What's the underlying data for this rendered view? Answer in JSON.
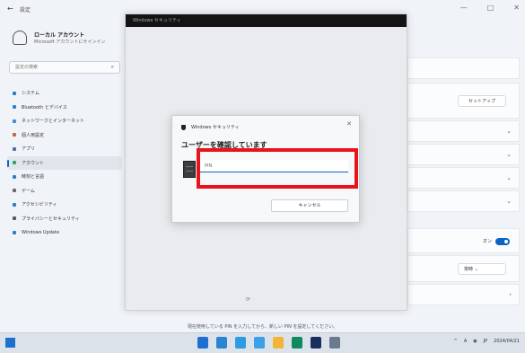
{
  "settings": {
    "back": "←",
    "app_title": "設定",
    "window_controls": [
      "—",
      "□",
      "✕"
    ],
    "profile": {
      "name": "ローカル アカウント",
      "subtitle": "Microsoft アカウントにサインイン"
    },
    "search_placeholder": "設定の検索",
    "nav": [
      {
        "label": "システム",
        "color": "#2f7bd6"
      },
      {
        "label": "Bluetooth とデバイス",
        "color": "#2f7bd6"
      },
      {
        "label": "ネットワークとインターネット",
        "color": "#3b8fd9"
      },
      {
        "label": "個人用設定",
        "color": "#c56a36"
      },
      {
        "label": "アプリ",
        "color": "#4e6fa8"
      },
      {
        "label": "アカウント",
        "color": "#2fa36b",
        "active": true
      },
      {
        "label": "時刻と言語",
        "color": "#2f7bd6"
      },
      {
        "label": "ゲーム",
        "color": "#6a6a6a"
      },
      {
        "label": "アクセシビリティ",
        "color": "#2f7bd6"
      },
      {
        "label": "プライバシーとセキュリティ",
        "color": "#5a5a5a"
      },
      {
        "label": "Windows Update",
        "color": "#2f7bd6"
      }
    ],
    "right_cards": {
      "button_label": "セットアップ",
      "toggle_label": "オン",
      "select_label": "常時"
    }
  },
  "security_window": {
    "title": "Windows セキュリティ",
    "footer": "⟳"
  },
  "dialog": {
    "header": "Windows セキュリティ",
    "close": "✕",
    "title": "ユーザーを確認しています",
    "pin_placeholder": "PIN",
    "cancel_label": "キャンセル"
  },
  "status_line": "現在使用している PIN を入力してから、新しい PIN を設定してください。",
  "taskbar": {
    "tray": [
      "^",
      "A",
      "◉",
      "JP",
      "2024/04/21"
    ],
    "icon_colors": [
      "#1f6fd1",
      "#2b83d3",
      "#2e9adf",
      "#3ba0e8",
      "#f2b53a",
      "#0f8a5f",
      "#1a2e5e",
      "#6b7a8f"
    ]
  },
  "colors": {
    "accent": "#0a64c8",
    "highlight": "#e8141a"
  }
}
